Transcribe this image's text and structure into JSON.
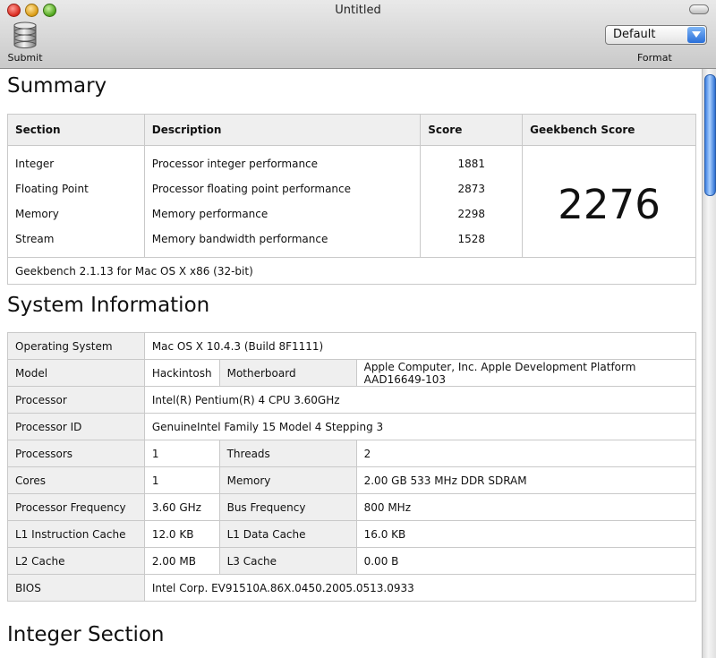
{
  "window": {
    "title": "Untitled"
  },
  "toolbar": {
    "submit_label": "Submit",
    "format_label": "Format",
    "format_selected": "Default",
    "submit_icon": "database-icon"
  },
  "summary": {
    "title": "Summary",
    "headers": [
      "Section",
      "Description",
      "Score",
      "Geekbench Score"
    ],
    "rows": [
      {
        "section": "Integer",
        "description": "Processor integer performance",
        "score": "1881"
      },
      {
        "section": "Floating Point",
        "description": "Processor floating point performance",
        "score": "2873"
      },
      {
        "section": "Memory",
        "description": "Memory performance",
        "score": "2298"
      },
      {
        "section": "Stream",
        "description": "Memory bandwidth performance",
        "score": "1528"
      }
    ],
    "geekbench_score": "2276",
    "footer": "Geekbench 2.1.13 for Mac OS X x86 (32-bit)"
  },
  "system": {
    "title": "System Information",
    "os_label": "Operating System",
    "os_value": "Mac OS X 10.4.3 (Build 8F1111)",
    "model_label": "Model",
    "model_value": "Hackintosh",
    "motherboard_label": "Motherboard",
    "motherboard_value": "Apple Computer, Inc. Apple Development Platform AAD16649-103",
    "processor_label": "Processor",
    "processor_value": "Intel(R) Pentium(R) 4 CPU 3.60GHz",
    "processor_id_label": "Processor ID",
    "processor_id_value": "GenuineIntel Family 15 Model 4 Stepping 3",
    "processors_label": "Processors",
    "processors_value": "1",
    "threads_label": "Threads",
    "threads_value": "2",
    "cores_label": "Cores",
    "cores_value": "1",
    "memory_label": "Memory",
    "memory_value": "2.00 GB  533 MHz DDR SDRAM",
    "freq_label": "Processor Frequency",
    "freq_value": "3.60 GHz",
    "bus_label": "Bus Frequency",
    "bus_value": "800 MHz",
    "l1i_label": "L1 Instruction Cache",
    "l1i_value": "12.0 KB",
    "l1d_label": "L1 Data Cache",
    "l1d_value": "16.0 KB",
    "l2_label": "L2 Cache",
    "l2_value": "2.00 MB",
    "l3_label": "L3 Cache",
    "l3_value": "0.00 B",
    "bios_label": "BIOS",
    "bios_value": "Intel Corp. EV91510A.86X.0450.2005.0513.0933"
  },
  "integer_section": {
    "title": "Integer Section"
  }
}
